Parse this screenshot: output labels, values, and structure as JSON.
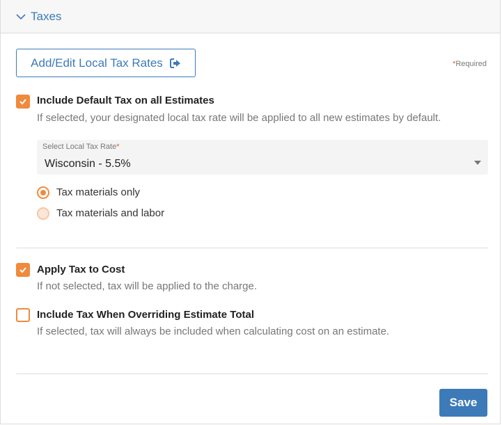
{
  "section": {
    "title": "Taxes",
    "icon": "chevron-down-icon"
  },
  "local_tax_button": {
    "label": "Add/Edit Local Tax Rates",
    "icon": "sign-out-icon"
  },
  "required_note": {
    "asterisk": "*",
    "text": "Required"
  },
  "include_default_tax": {
    "checked": true,
    "label": "Include Default Tax on all Estimates",
    "help": "If selected, your designated local tax rate will be applied to all new estimates by default."
  },
  "local_tax_select": {
    "label": "Select Local Tax Rate",
    "required_marker": "*",
    "value": "Wisconsin - 5.5%"
  },
  "tax_scope": {
    "options": [
      {
        "label": "Tax materials only",
        "selected": true
      },
      {
        "label": "Tax materials and labor",
        "selected": false
      }
    ]
  },
  "apply_tax_to_cost": {
    "checked": true,
    "label": "Apply Tax to Cost",
    "help": "If not selected, tax will be applied to the charge."
  },
  "include_tax_override": {
    "checked": false,
    "label": "Include Tax When Overriding Estimate Total",
    "help": "If selected, tax will always be included when calculating cost on an estimate."
  },
  "save_button": {
    "label": "Save"
  },
  "colors": {
    "accent_blue": "#3d7ab8",
    "accent_orange": "#f08a3c",
    "required_red": "#e05a3a"
  }
}
